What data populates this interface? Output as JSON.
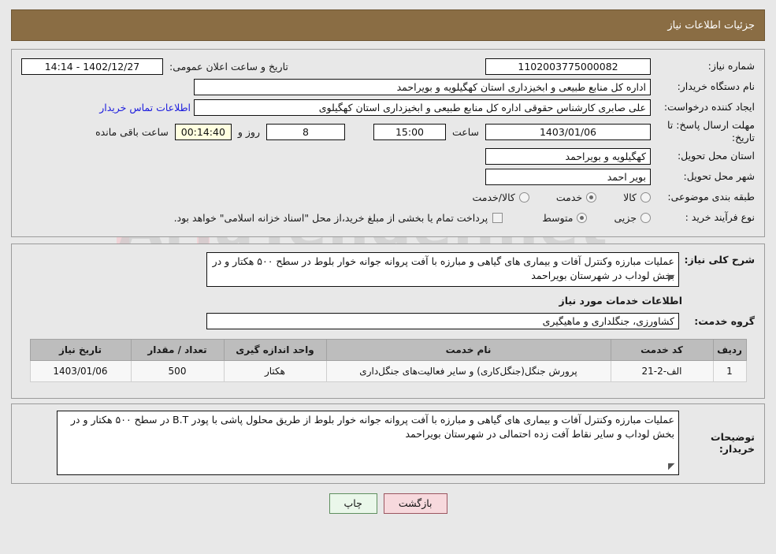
{
  "header": {
    "title": "جزئیات اطلاعات نیاز",
    "bar_color": "#8a6d44"
  },
  "details": {
    "need_number_label": "شماره نیاز:",
    "need_number_value": "1102003775000082",
    "announce_datetime_label": "تاریخ و ساعت اعلان عمومی:",
    "announce_datetime_value": "1402/12/27 - 14:14",
    "buyer_org_label": "نام دستگاه خریدار:",
    "buyer_org_value": "اداره کل منابع طبیعی و ابخیزداری استان کهگیلویه و بویراحمد",
    "requester_label": "ایجاد کننده درخواست:",
    "requester_value": "علی صابری کارشناس حقوقی اداره کل منابع طبیعی و ابخیزداری استان کهگیلوی",
    "contact_link": "اطلاعات تماس خریدار",
    "deadline_label": "مهلت ارسال پاسخ: تا تاریخ:",
    "deadline_date": "1403/01/06",
    "deadline_time_label": "ساعت",
    "deadline_time": "15:00",
    "remaining_days": "8",
    "remaining_days_label": "روز و",
    "remaining_clock": "00:14:40",
    "remaining_clock_label": "ساعت باقی مانده",
    "province_label": "استان محل تحویل:",
    "province_value": "کهگیلویه و بویراحمد",
    "city_label": "شهر محل تحویل:",
    "city_value": "بویر احمد",
    "category_label": "طبقه بندی موضوعی:",
    "category_options": [
      {
        "label": "کالا",
        "selected": false
      },
      {
        "label": "خدمت",
        "selected": true
      },
      {
        "label": "کالا/خدمت",
        "selected": false
      }
    ],
    "process_label": "نوع فرآیند خرید :",
    "process_options": [
      {
        "label": "جزیی",
        "selected": false
      },
      {
        "label": "متوسط",
        "selected": true
      }
    ],
    "treasury_checkbox_checked": false,
    "treasury_text": "پرداخت تمام یا بخشی از مبلغ خرید،از محل \"اسناد خزانه اسلامی\" خواهد بود."
  },
  "need_summary": {
    "label": "شرح کلی نیاز:",
    "value": "عملیات مبارزه وکنترل آفات و بیماری های گیاهی و مبارزه با آفت پروانه جوانه خوار بلوط در سطح ۵۰۰ هکتار و در بخش لوداب در شهرستان بویراحمد"
  },
  "services_section": {
    "heading": "اطلاعات خدمات مورد نیاز",
    "group_label": "گروه خدمت:",
    "group_value": "کشاورزی، جنگلداری و ماهیگیری",
    "table": {
      "columns": [
        "ردیف",
        "کد خدمت",
        "نام خدمت",
        "واحد اندازه گیری",
        "تعداد / مقدار",
        "تاریخ نیاز"
      ],
      "rows": [
        {
          "radif": "1",
          "code": "الف-2-21",
          "name": "پرورش جنگل(جنگل‌کاری) و سایر فعالیت‌های جنگل‌داری",
          "unit": "هکتار",
          "qty": "500",
          "date": "1403/01/06"
        }
      ]
    }
  },
  "buyer_notes": {
    "label": "توضیحات خریدار:",
    "value": "عملیات مبارزه وکنترل آفات و بیماری های گیاهی و مبارزه با آفت پروانه جوانه خوار بلوط از طریق محلول پاشی با پودر B.T در سطح ۵۰۰ هکتار و در بخش لوداب و سایر نقاط آفت زده احتمالی در شهرستان بویراحمد"
  },
  "footer": {
    "print_label": "چاپ",
    "back_label": "بازگشت"
  }
}
